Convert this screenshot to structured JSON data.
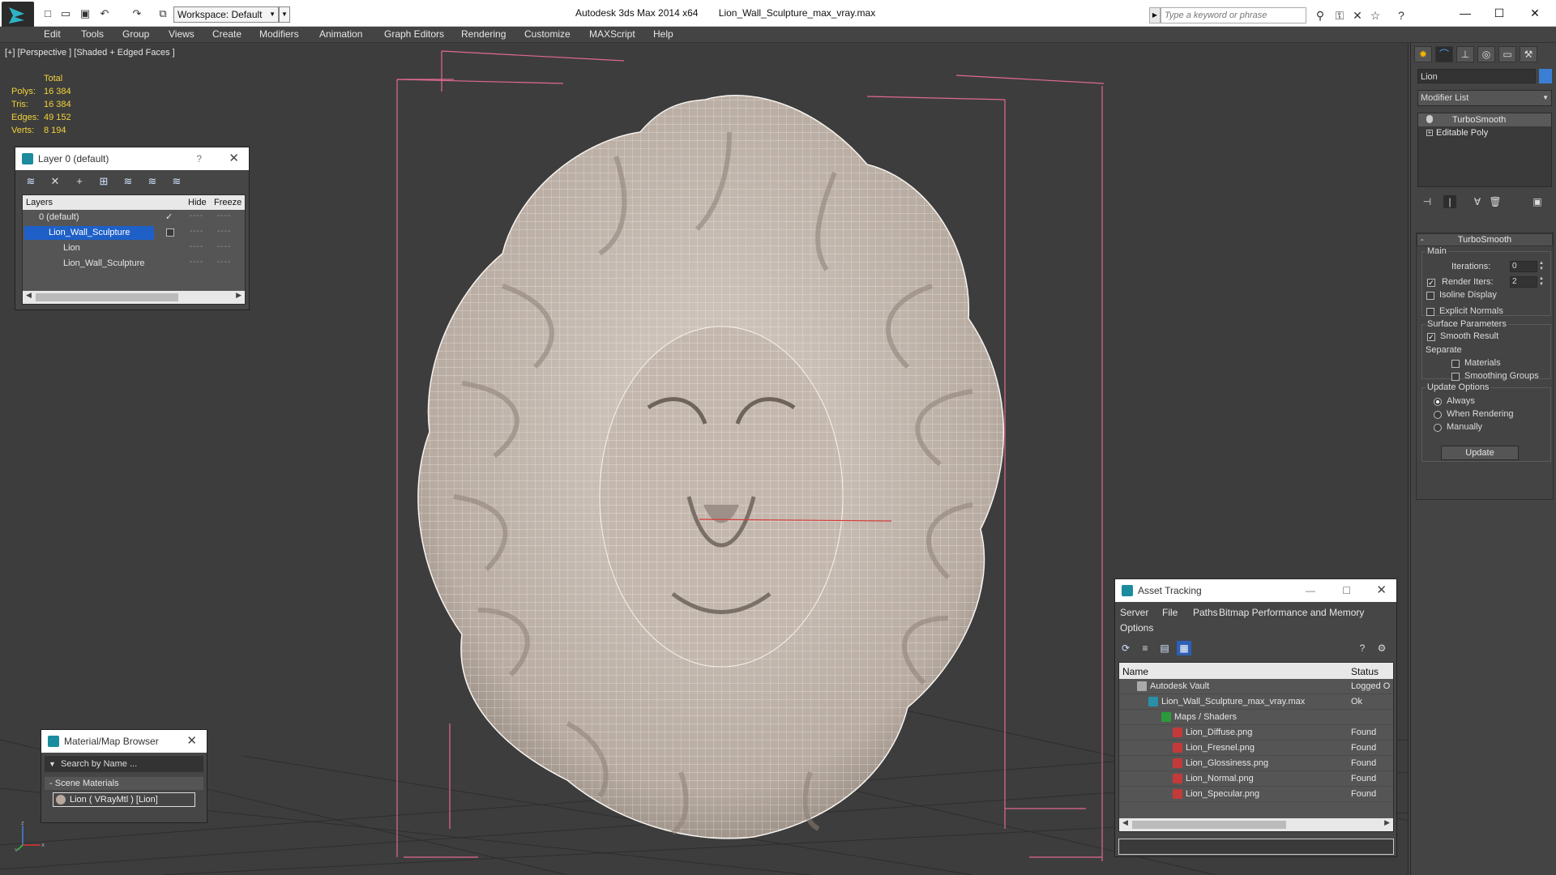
{
  "titlebar": {
    "app_name": "Autodesk 3ds Max  2014 x64",
    "file_name": "Lion_Wall_Sculpture_max_vray.max",
    "workspace": "Workspace: Default",
    "search_placeholder": "Type a keyword or phrase"
  },
  "menu": [
    "Edit",
    "Tools",
    "Group",
    "Views",
    "Create",
    "Modifiers",
    "Animation",
    "Graph Editors",
    "Rendering",
    "Customize",
    "MAXScript",
    "Help"
  ],
  "viewport": {
    "label": "[+] [Perspective ] [Shaded + Edged Faces ]",
    "stats": {
      "total_label": "Total",
      "rows": [
        {
          "k": "Polys:",
          "v": "16 384"
        },
        {
          "k": "Tris:",
          "v": "16 384"
        },
        {
          "k": "Edges:",
          "v": "49 152"
        },
        {
          "k": "Verts:",
          "v": "8 194"
        }
      ]
    },
    "gizmo": {
      "x": "x",
      "y": "y",
      "z": "z"
    }
  },
  "layer_panel": {
    "title": "Layer 0 (default)",
    "help": "?",
    "columns": {
      "layers": "Layers",
      "hide": "Hide",
      "freeze": "Freeze"
    },
    "rows": [
      {
        "name": "0 (default)",
        "indent": 0,
        "selected": false
      },
      {
        "name": "Lion_Wall_Sculpture",
        "indent": 0,
        "selected": true
      },
      {
        "name": "Lion",
        "indent": 1,
        "selected": false
      },
      {
        "name": "Lion_Wall_Sculpture",
        "indent": 1,
        "selected": false
      }
    ],
    "dots": "----"
  },
  "material_browser": {
    "title": "Material/Map Browser",
    "search_placeholder": "Search by Name ...",
    "group": "Scene Materials",
    "item": "Lion  ( VRayMtl )  [Lion]"
  },
  "asset_tracking": {
    "title": "Asset Tracking",
    "menu": [
      "Server",
      "File",
      "Paths",
      "Bitmap Performance and Memory",
      "Options"
    ],
    "columns": {
      "name": "Name",
      "status": "Status"
    },
    "rows": [
      {
        "name": "Autodesk Vault",
        "status": "Logged O",
        "indent": 1
      },
      {
        "name": "Lion_Wall_Sculpture_max_vray.max",
        "status": "Ok",
        "indent": 2
      },
      {
        "name": "Maps / Shaders",
        "status": "",
        "indent": 3
      },
      {
        "name": "Lion_Diffuse.png",
        "status": "Found",
        "indent": 4
      },
      {
        "name": "Lion_Fresnel.png",
        "status": "Found",
        "indent": 4
      },
      {
        "name": "Lion_Glossiness.png",
        "status": "Found",
        "indent": 4
      },
      {
        "name": "Lion_Normal.png",
        "status": "Found",
        "indent": 4
      },
      {
        "name": "Lion_Specular.png",
        "status": "Found",
        "indent": 4
      }
    ]
  },
  "command_panel": {
    "object_name": "Lion",
    "modifier_list": "Modifier List",
    "stack": [
      {
        "name": "TurboSmooth",
        "selected": true
      },
      {
        "name": "Editable Poly",
        "selected": false
      }
    ],
    "rollout_title": "TurboSmooth",
    "main_label": "Main",
    "iterations_label": "Iterations:",
    "iterations_value": "0",
    "render_iters_label": "Render Iters:",
    "render_iters_value": "2",
    "isoline_label": "Isoline Display",
    "explicit_label": "Explicit Normals",
    "surface_label": "Surface Parameters",
    "smooth_label": "Smooth Result",
    "separate_label": "Separate",
    "materials_label": "Materials",
    "smoothing_label": "Smoothing Groups",
    "update_options_label": "Update Options",
    "always_label": "Always",
    "when_rendering_label": "When Rendering",
    "manually_label": "Manually",
    "update_button": "Update"
  },
  "colors": {
    "accent": "#1e60c8",
    "stats_text": "#f2d23a",
    "bbox_lines": "#e26a8f",
    "mesh_fill": "#c9bdb4",
    "viewport_bg": "#3d3d3d"
  }
}
